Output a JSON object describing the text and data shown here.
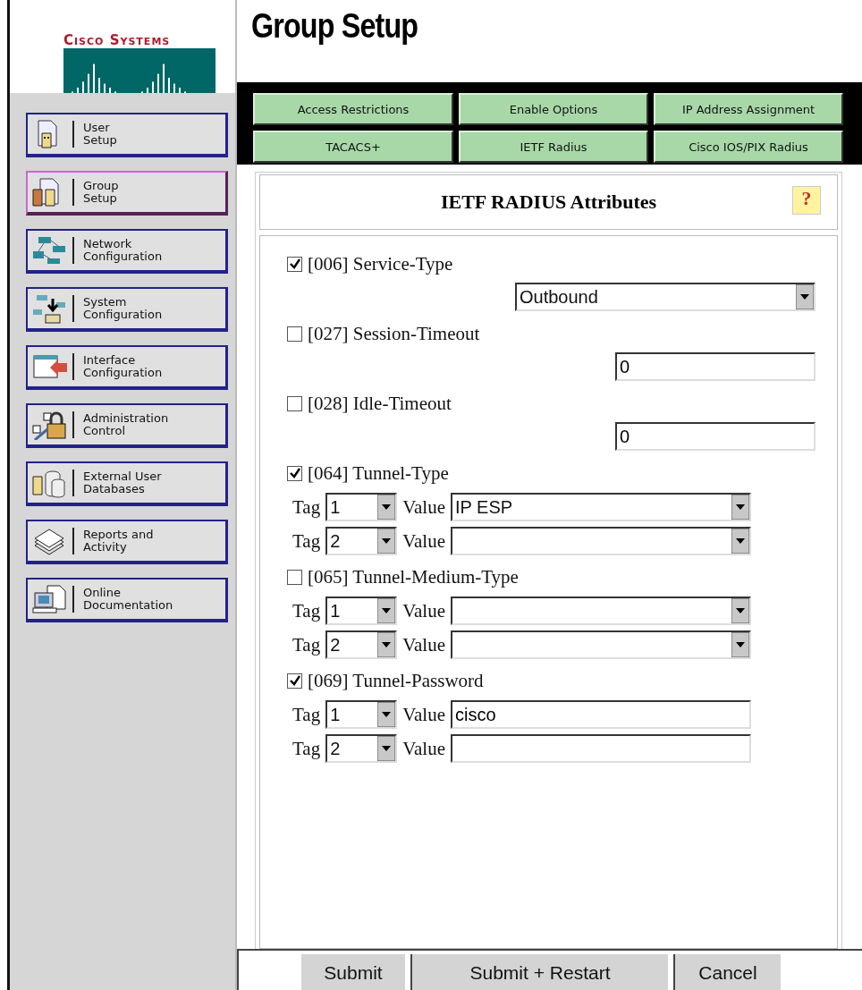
{
  "logo": {
    "text": "Cisco Systems"
  },
  "page_title": "Group Setup",
  "sidebar": {
    "items": [
      {
        "lines": [
          "User",
          "Setup"
        ],
        "selected": false
      },
      {
        "lines": [
          "Group",
          "Setup"
        ],
        "selected": true
      },
      {
        "lines": [
          "Network",
          "Configuration"
        ],
        "selected": false
      },
      {
        "lines": [
          "System",
          "Configuration"
        ],
        "selected": false
      },
      {
        "lines": [
          "Interface",
          "Configuration"
        ],
        "selected": false
      },
      {
        "lines": [
          "Administration",
          "Control"
        ],
        "selected": false
      },
      {
        "lines": [
          "External User",
          "Databases"
        ],
        "selected": false
      },
      {
        "lines": [
          "Reports and",
          "Activity"
        ],
        "selected": false
      },
      {
        "lines": [
          "Online",
          "Documentation"
        ],
        "selected": false
      }
    ]
  },
  "tabs": [
    {
      "label": "Access Restrictions"
    },
    {
      "label": "Enable Options"
    },
    {
      "label": "IP Address Assignment"
    },
    {
      "label": "TACACS+"
    },
    {
      "label": "IETF Radius"
    },
    {
      "label": "Cisco IOS/PIX Radius"
    }
  ],
  "panel": {
    "title": "IETF RADIUS Attributes",
    "help": "?"
  },
  "attributes": [
    {
      "kind": "select",
      "label": "[006] Service-Type",
      "checked": true,
      "value": "Outbound"
    },
    {
      "kind": "text",
      "label": "[027] Session-Timeout",
      "checked": false,
      "value": "0"
    },
    {
      "kind": "text",
      "label": "[028] Idle-Timeout",
      "checked": false,
      "value": "0"
    },
    {
      "kind": "tagged_select",
      "label": "[064] Tunnel-Type",
      "checked": true,
      "rows": [
        {
          "tag_label": "Tag",
          "tag": "1",
          "value_label": "Value",
          "value": "IP ESP"
        },
        {
          "tag_label": "Tag",
          "tag": "2",
          "value_label": "Value"
        }
      ]
    },
    {
      "kind": "tagged_select",
      "label": "[065] Tunnel-Medium-Type",
      "checked": false,
      "rows": [
        {
          "tag_label": "Tag",
          "tag": "1",
          "value_label": "Value"
        },
        {
          "tag_label": "Tag",
          "tag": "2",
          "value_label": "Value"
        }
      ]
    },
    {
      "kind": "tagged_text",
      "label": "[069] Tunnel-Password",
      "checked": true,
      "rows": [
        {
          "tag_label": "Tag",
          "tag": "1",
          "value_label": "Value",
          "value": "cisco"
        },
        {
          "tag_label": "Tag",
          "tag": "2",
          "value_label": "Value"
        }
      ]
    }
  ],
  "buttons": [
    "Submit",
    "Submit + Restart",
    "Cancel"
  ]
}
